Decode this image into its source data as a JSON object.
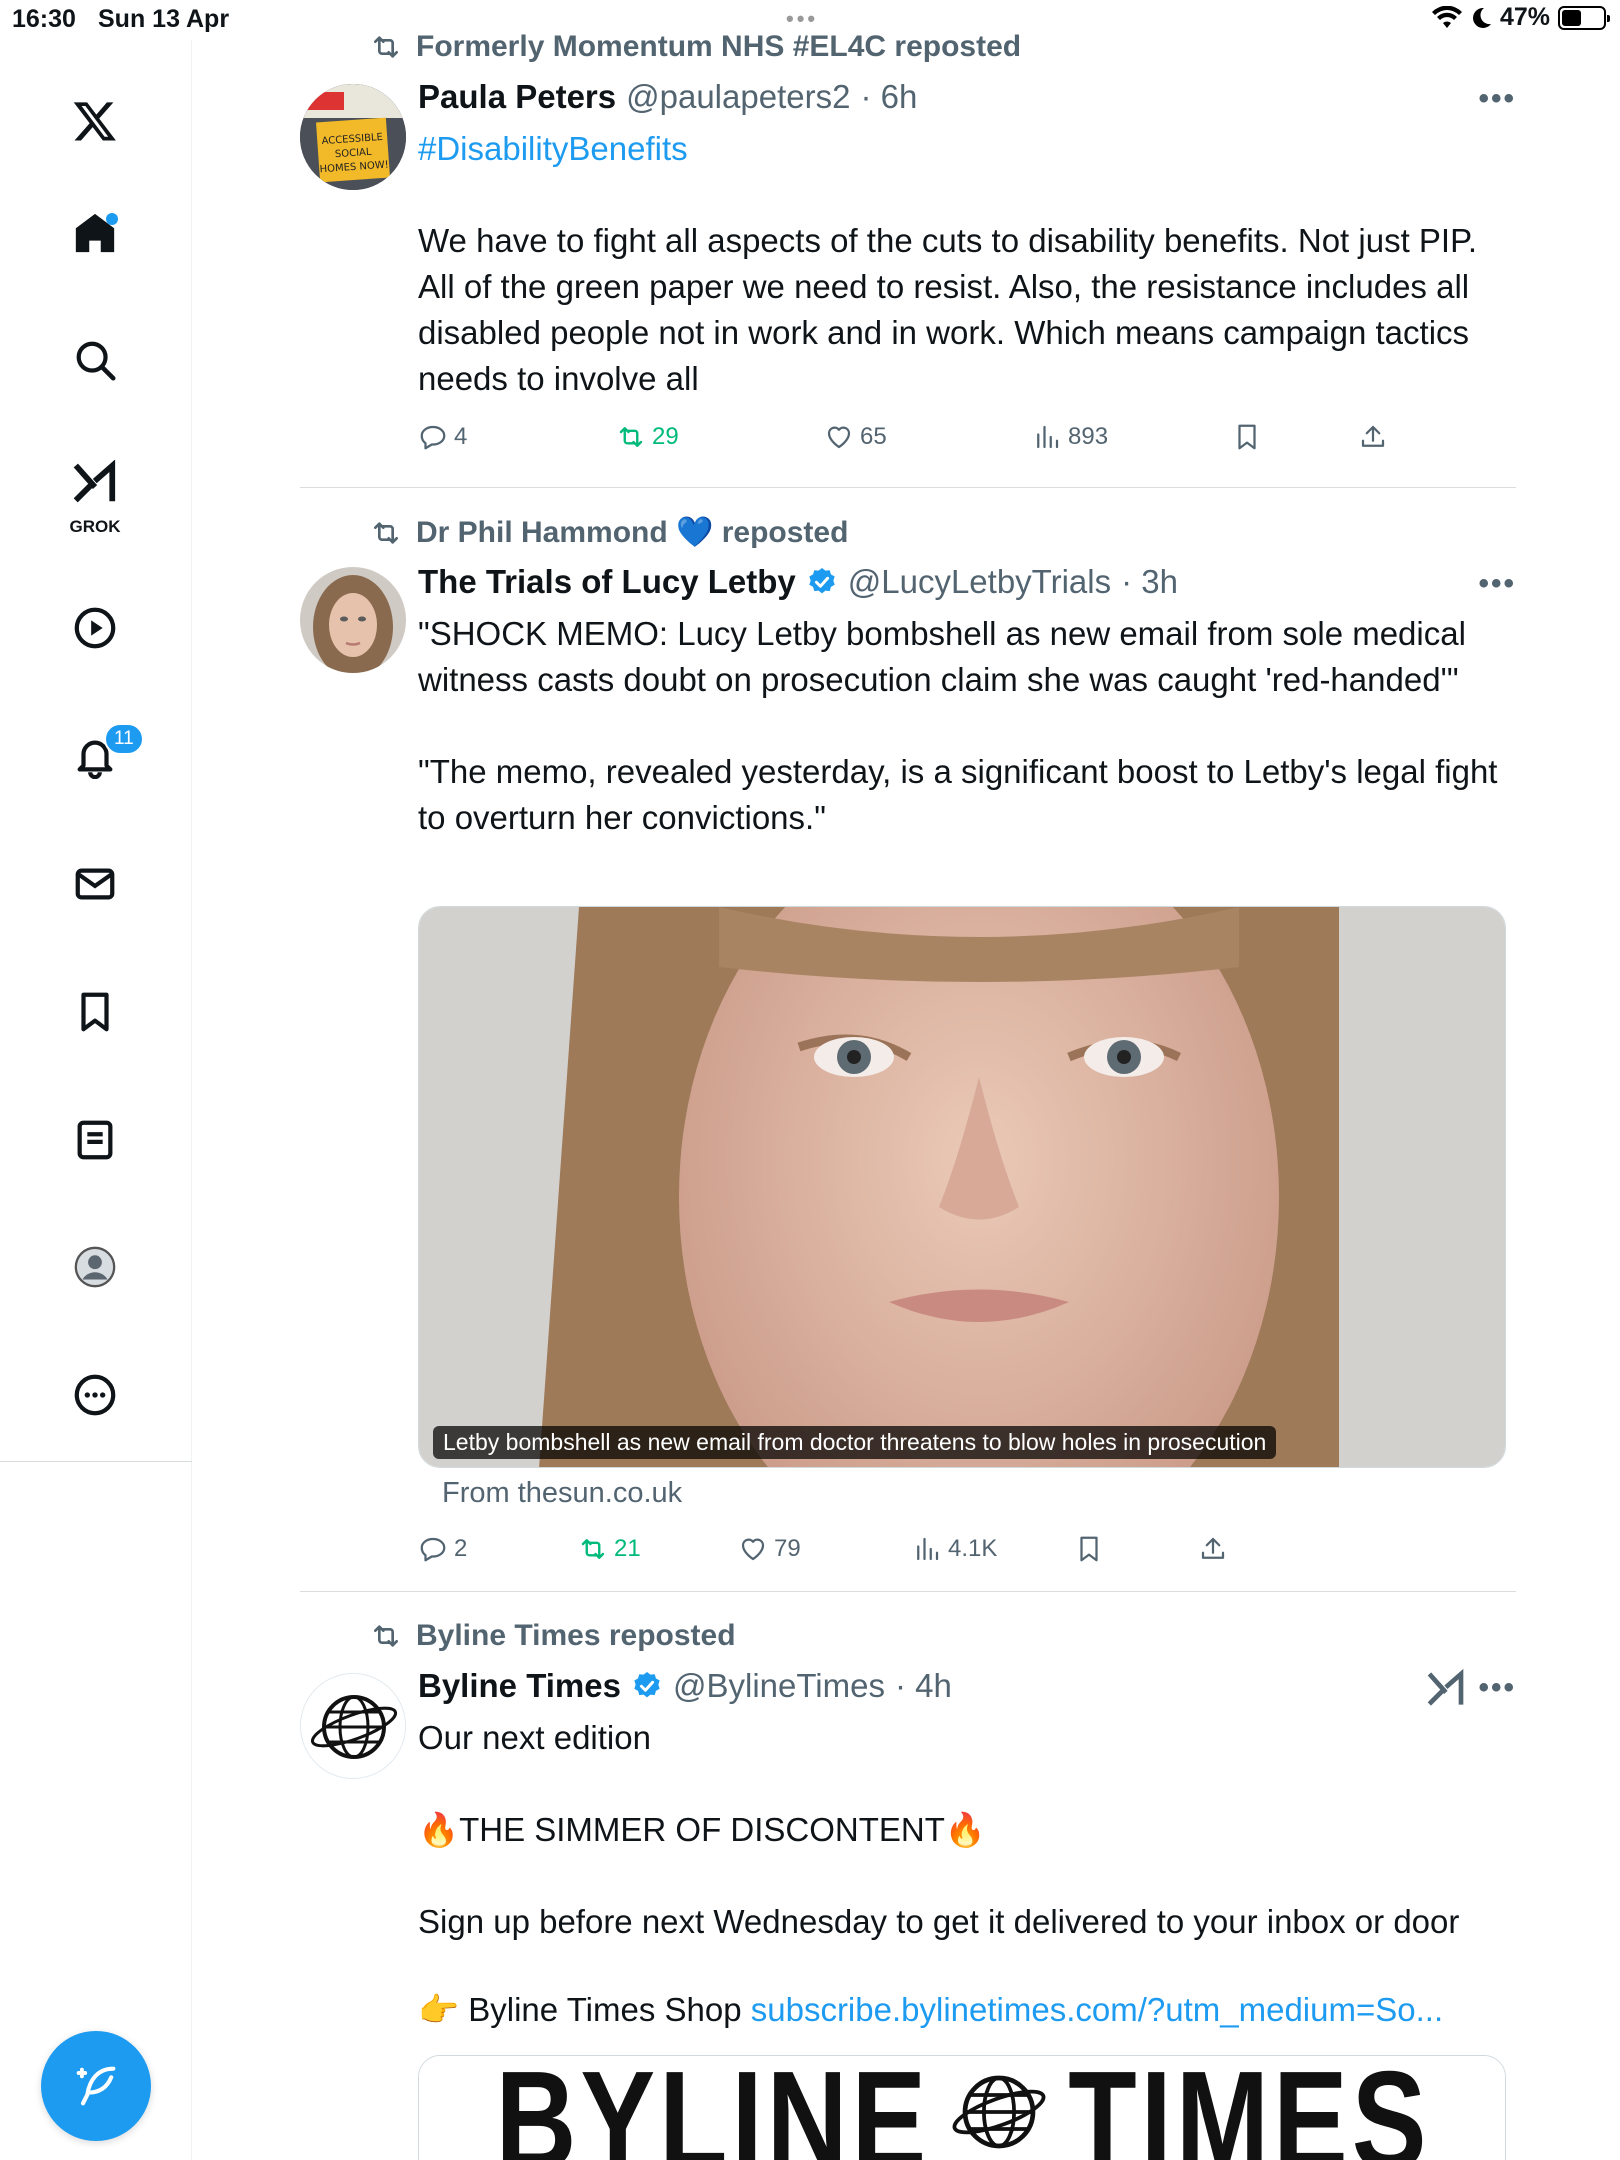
{
  "status": {
    "time": "16:30",
    "date": "Sun 13 Apr",
    "battery": "47%",
    "battery_level": 0.47
  },
  "sidebar": {
    "items": [
      {
        "name": "x-logo-icon"
      },
      {
        "name": "home-icon"
      },
      {
        "name": "search-icon"
      },
      {
        "name": "grok-icon",
        "label": "GROK"
      },
      {
        "name": "video-icon"
      },
      {
        "name": "notifications-icon",
        "badge": "11"
      },
      {
        "name": "messages-icon"
      },
      {
        "name": "bookmarks-icon"
      },
      {
        "name": "lists-icon"
      },
      {
        "name": "profile-icon"
      },
      {
        "name": "more-icon"
      }
    ]
  },
  "tweets": [
    {
      "repost_by": "Formerly Momentum NHS #EL4C reposted",
      "name": "Paula Peters",
      "handle": "@paulapeters2",
      "time": "· 6h",
      "hashtag": "#DisabilityBenefits",
      "text": "We have to fight all aspects of the cuts to disability benefits. Not just PIP. All of the green paper we need to resist. Also, the resistance includes all disabled people not in work and in work. Which means campaign tactics needs to involve all",
      "replies": "4",
      "reposts": "29",
      "likes": "65",
      "views": "893",
      "avatar_sign": "ACCESSIBLE SOCIAL HOMES NOW!"
    },
    {
      "repost_by": "Dr Phil Hammond 💙 reposted",
      "name": "The Trials of Lucy Letby",
      "handle": "@LucyLetbyTrials",
      "time": "· 3h",
      "text": "\"SHOCK MEMO: Lucy Letby bombshell as new email from sole medical witness casts doubt on prosecution claim she was caught 'red-handed'\"\n\n\"The memo, revealed yesterday, is a significant boost to Letby's legal fight to overturn her convictions.\"",
      "card_caption": "Letby bombshell as new email from doctor threatens to blow holes in prosecution",
      "card_source": "From thesun.co.uk",
      "replies": "2",
      "reposts": "21",
      "likes": "79",
      "views": "4.1K"
    },
    {
      "repost_by": "Byline Times reposted",
      "name": "Byline Times",
      "handle": "@BylineTimes",
      "time": "· 4h",
      "text_1": "Our next edition",
      "text_2": "🔥THE SIMMER OF DISCONTENT🔥",
      "text_3": "Sign up before next Wednesday to get it delivered to your inbox or door",
      "text_4": "👉 Byline Times Shop ",
      "link": "subscribe.bylinetimes.com/?utm_medium=So...",
      "card_logo_left": "BYLINE",
      "card_logo_right": "TIMES"
    }
  ]
}
